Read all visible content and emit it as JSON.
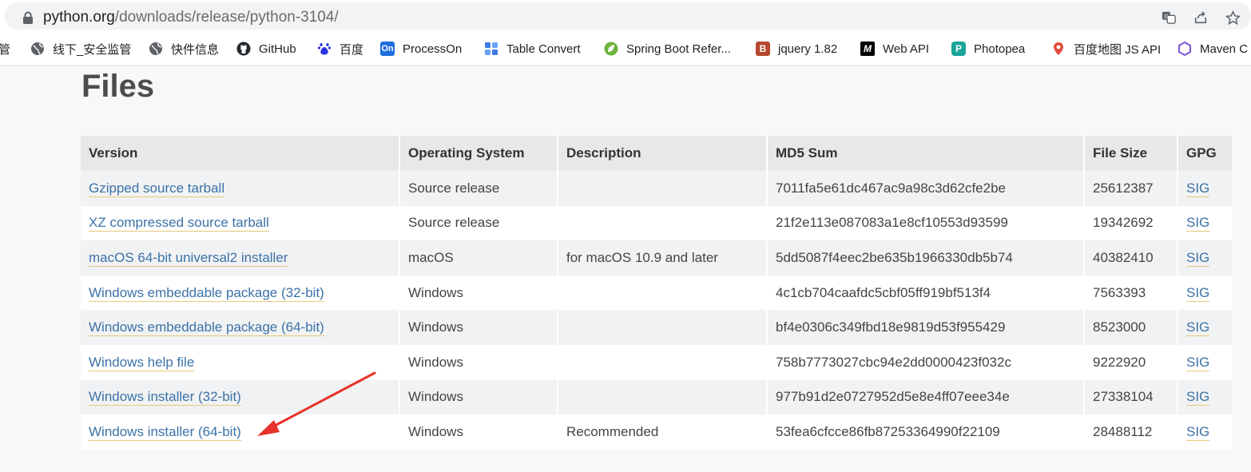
{
  "browser": {
    "url_host": "python.org",
    "url_path": "/downloads/release/python-3104/",
    "actions": [
      "translate-icon",
      "share-icon",
      "star-icon"
    ]
  },
  "bookmarks": [
    {
      "label": "管",
      "icon": "folder-icon",
      "color": "#ffffff"
    },
    {
      "label": "线下_安全监管",
      "icon": "globe-icon",
      "color": "#5f6368"
    },
    {
      "label": "快件信息",
      "icon": "globe-icon",
      "color": "#5f6368"
    },
    {
      "label": "GitHub",
      "icon": "github-icon",
      "color": "#24292e"
    },
    {
      "label": "百度",
      "icon": "baidu-icon",
      "color": "#2932e1"
    },
    {
      "label": "ProcessOn",
      "icon": "processon-icon",
      "color": "#1f6fde"
    },
    {
      "label": "Table Convert",
      "icon": "table-convert-icon",
      "color": "#3d7be0"
    },
    {
      "label": "Spring Boot Refer...",
      "icon": "spring-icon",
      "color": "#6db33f"
    },
    {
      "label": "jquery 1.82",
      "icon": "jquery-icon",
      "color": "#b5472d"
    },
    {
      "label": "Web API",
      "icon": "mdn-icon",
      "color": "#000000"
    },
    {
      "label": "Photopea",
      "icon": "photopea-icon",
      "color": "#18a497"
    },
    {
      "label": "百度地图 JS API",
      "icon": "map-pin-icon",
      "color": "#e24a3c"
    },
    {
      "label": "Maven C",
      "icon": "maven-icon",
      "color": "#7b57d6"
    }
  ],
  "page": {
    "title": "Files"
  },
  "table": {
    "headers": [
      "Version",
      "Operating System",
      "Description",
      "MD5 Sum",
      "File Size",
      "GPG"
    ],
    "rows": [
      {
        "version": "Gzipped source tarball",
        "os": "Source release",
        "description": "",
        "md5": "7011fa5e61dc467ac9a98c3d62cfe2be",
        "size": "25612387",
        "gpg": "SIG"
      },
      {
        "version": "XZ compressed source tarball",
        "os": "Source release",
        "description": "",
        "md5": "21f2e113e087083a1e8cf10553d93599",
        "size": "19342692",
        "gpg": "SIG"
      },
      {
        "version": "macOS 64-bit universal2 installer",
        "os": "macOS",
        "description": "for macOS 10.9 and later",
        "md5": "5dd5087f4eec2be635b1966330db5b74",
        "size": "40382410",
        "gpg": "SIG"
      },
      {
        "version": "Windows embeddable package (32-bit)",
        "os": "Windows",
        "description": "",
        "md5": "4c1cb704caafdc5cbf05ff919bf513f4",
        "size": "7563393",
        "gpg": "SIG"
      },
      {
        "version": "Windows embeddable package (64-bit)",
        "os": "Windows",
        "description": "",
        "md5": "bf4e0306c349fbd18e9819d53f955429",
        "size": "8523000",
        "gpg": "SIG"
      },
      {
        "version": "Windows help file",
        "os": "Windows",
        "description": "",
        "md5": "758b7773027cbc94e2dd0000423f032c",
        "size": "9222920",
        "gpg": "SIG"
      },
      {
        "version": "Windows installer (32-bit)",
        "os": "Windows",
        "description": "",
        "md5": "977b91d2e0727952d5e8e4ff07eee34e",
        "size": "27338104",
        "gpg": "SIG"
      },
      {
        "version": "Windows installer (64-bit)",
        "os": "Windows",
        "description": "Recommended",
        "md5": "53fea6cfcce86fb87253364990f22109",
        "size": "28488112",
        "gpg": "SIG"
      }
    ]
  },
  "annotation": {
    "arrow_color": "#e8332a",
    "points_to": "Windows installer (64-bit)"
  }
}
